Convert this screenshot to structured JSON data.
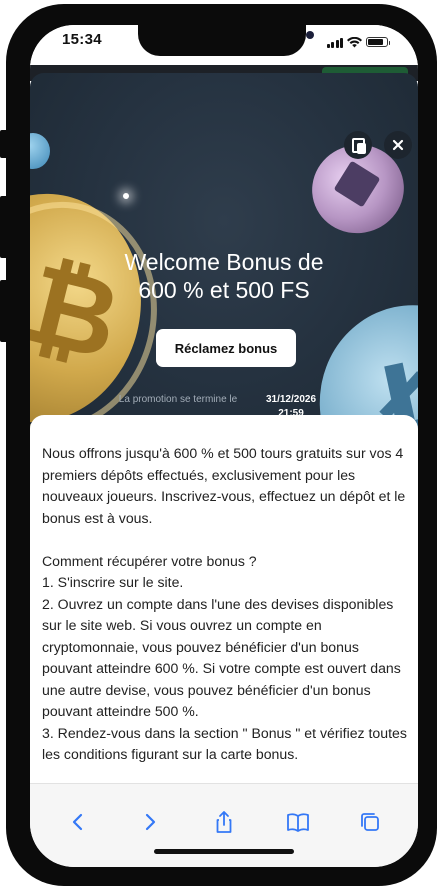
{
  "status_bar": {
    "time": "15:34"
  },
  "modal": {
    "title_line1": "Welcome Bonus de",
    "title_line2": "600 % et 500 FS",
    "claim_button": "Réclamez bonus",
    "promo_label": "La promotion se termine le",
    "promo_date": "31/12/2026",
    "promo_time": "21:59",
    "description": "Nous offrons jusqu'à 600 % et 500 tours gratuits sur vos 4 premiers dépôts effectués, exclusivement pour les nouveaux joueurs. Inscrivez-vous, effectuez un dépôt et le bonus est à vous.\n\nComment récupérer votre bonus ?\n1. S'inscrire sur le site.\n2. Ouvrez un compte dans l'une des devises disponibles sur le site web. Si vous ouvrez un compte en cryptomonnaie, vous pouvez bénéficier d'un bonus pouvant atteindre 600 %. Si votre compte est ouvert dans une autre devise, vous pouvez bénéficier d'un bonus pouvant atteindre 500 %.\n3. Rendez-vous dans la section \" Bonus \" et vérifiez toutes les conditions figurant sur la carte bonus."
  },
  "toolbar": {
    "icons": [
      "back-icon",
      "forward-icon",
      "share-icon",
      "bookmarks-icon",
      "tabs-icon"
    ],
    "accent_color": "#3478f6"
  }
}
